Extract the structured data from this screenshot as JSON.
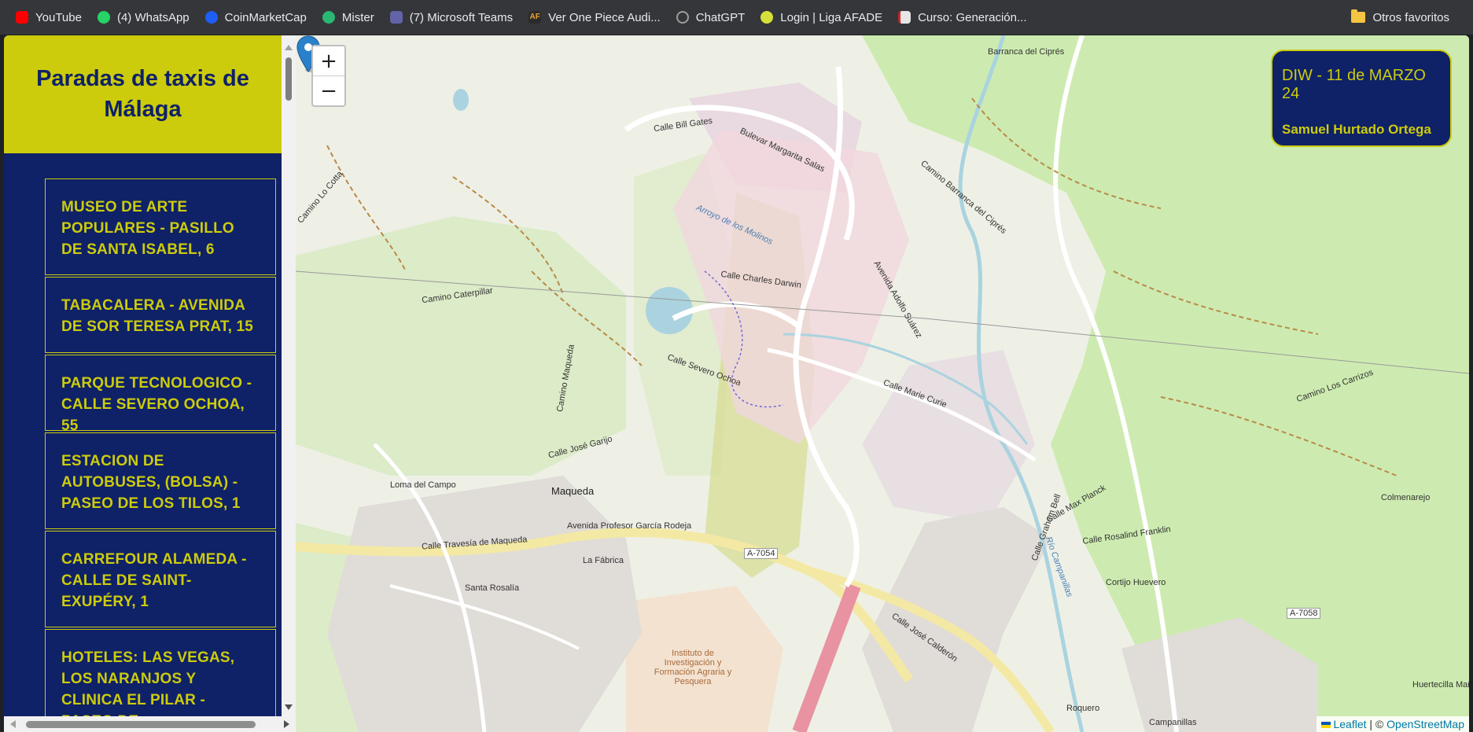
{
  "bookmarks": [
    {
      "label": "YouTube",
      "icon": "youtube-icon",
      "color": "#ff0000"
    },
    {
      "label": "(4) WhatsApp",
      "icon": "whatsapp-icon",
      "color": "#25d366"
    },
    {
      "label": "CoinMarketCap",
      "icon": "coinmarketcap-icon",
      "color": "#1e5ef3"
    },
    {
      "label": "Mister",
      "icon": "mister-icon",
      "color": "#2bb673"
    },
    {
      "label": "(7) Microsoft Teams",
      "icon": "teams-icon",
      "color": "#6264a7"
    },
    {
      "label": "Ver One Piece Audi...",
      "icon": "af-icon",
      "color": "#2b2b2b"
    },
    {
      "label": "ChatGPT",
      "icon": "chatgpt-icon",
      "color": "#9e9e9e"
    },
    {
      "label": "Login | Liga AFADE",
      "icon": "bulb-icon",
      "color": "#d6e03a"
    },
    {
      "label": "Curso: Generación...",
      "icon": "course-icon",
      "color": "#e6e6e6"
    }
  ],
  "other_bookmarks": "Otros favoritos",
  "sidebar": {
    "title": "Paradas de taxis de Málaga",
    "stops": [
      "MUSEO DE ARTE POPULARES - PASILLO DE SANTA ISABEL, 6",
      "TABACALERA - AVENIDA DE SOR TERESA PRAT, 15",
      "PARQUE TECNOLOGICO - CALLE SEVERO OCHOA, 55",
      "ESTACION DE AUTOBUSES, (BOLSA) - PASEO DE LOS TILOS, 1",
      "CARREFOUR ALAMEDA - CALLE DE SAINT-EXUPÉRY, 1",
      "HOTELES: LAS VEGAS, LOS NARANJOS Y CLINICA EL PILAR - PASEO DE"
    ]
  },
  "map": {
    "zoom_in": "+",
    "zoom_out": "−",
    "info_date": "DIW - 11 de MARZO 24",
    "info_name": "Samuel Hurtado Ortega",
    "attribution_leaflet": "Leaflet",
    "attribution_sep": " | © ",
    "attribution_osm": "OpenStreetMap",
    "places": [
      "Loma del Campo",
      "Maqueda",
      "La Fábrica",
      "Santa Rosalía",
      "Cortijo Huevero",
      "Colmenarejo",
      "Huertecilla Mañas",
      "Roquero",
      "Campanillas",
      "Barranca del Ciprés"
    ],
    "streets": [
      "Calle Travesía de Maqueda",
      "Avenida Profesor García Rodeja",
      "A-7054",
      "Calle José Calderón",
      "A-7058",
      "Calle Severo Ochoa",
      "Calle Charles Darwin",
      "Calle Marie Curie",
      "Avenida Adolfo Suárez",
      "Calle Bill Gates",
      "Bulevar Margarita Salas",
      "Camino Caterpillar",
      "Arroyo de los Molinos",
      "Río Campanillas",
      "Camino Barranca del Ciprés",
      "Calle José Garijo",
      "Calle Graham Bell",
      "Calle Max Planck",
      "Calle Rosalind Franklin",
      "Camino Los Carrizos",
      "Camino Lo Cotta",
      "Camino Maqueda",
      "Instituto de Investigación y Formación Agraria y Pesquera"
    ]
  },
  "colors": {
    "navy": "#0f2167",
    "yellow": "#cccc0c"
  }
}
